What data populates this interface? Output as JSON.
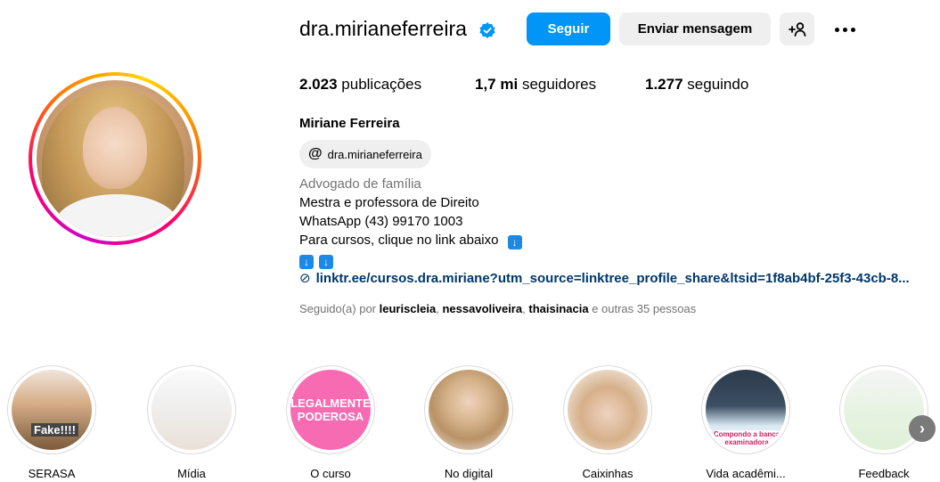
{
  "profile": {
    "username": "dra.mirianeferreira",
    "full_name": "Miriane Ferreira",
    "threads_handle": "dra.mirianeferreira",
    "category": "Advogado de família",
    "bio_lines": [
      "Mestra e professora de Direito",
      "WhatsApp (43) 99170 1003",
      "Para cursos, clique no link abaixo"
    ],
    "link": "linktr.ee/cursos.dra.miriane?utm_source=linktree_profile_share&ltsid=1f8ab4bf-25f3-43cb-8...",
    "verified_icon": "verified-badge-icon"
  },
  "actions": {
    "follow_label": "Seguir",
    "message_label": "Enviar mensagem",
    "suggest_icon": "+♔",
    "more_icon": "ellipsis-icon"
  },
  "stats": {
    "posts_value": "2.023",
    "posts_label": "publicações",
    "followers_value": "1,7 mi",
    "followers_label": "seguidores",
    "following_value": "1.277",
    "following_label": "seguindo"
  },
  "followed_by": {
    "prefix": "Seguido(a) por",
    "names": [
      "leuriscleia",
      "nessavoliveira",
      "thaisinacia"
    ],
    "sep1": ",",
    "sep2": ",",
    "suffix": "e outras 35 pessoas"
  },
  "highlights": [
    {
      "label": "SERASA"
    },
    {
      "label": "Mídia"
    },
    {
      "label": "O curso",
      "cover_text": "LEGALMENTE PODEROSA"
    },
    {
      "label": "No digital"
    },
    {
      "label": "Caixinhas"
    },
    {
      "label": "Vida acadêmi..."
    },
    {
      "label": "Feedback"
    }
  ],
  "highlight_overlays": {
    "serasa": "Fake!!!!",
    "vida": "Compondo a banca examinadora"
  },
  "colors": {
    "accent": "#0095f6",
    "link": "#00376b",
    "muted": "#737373"
  }
}
